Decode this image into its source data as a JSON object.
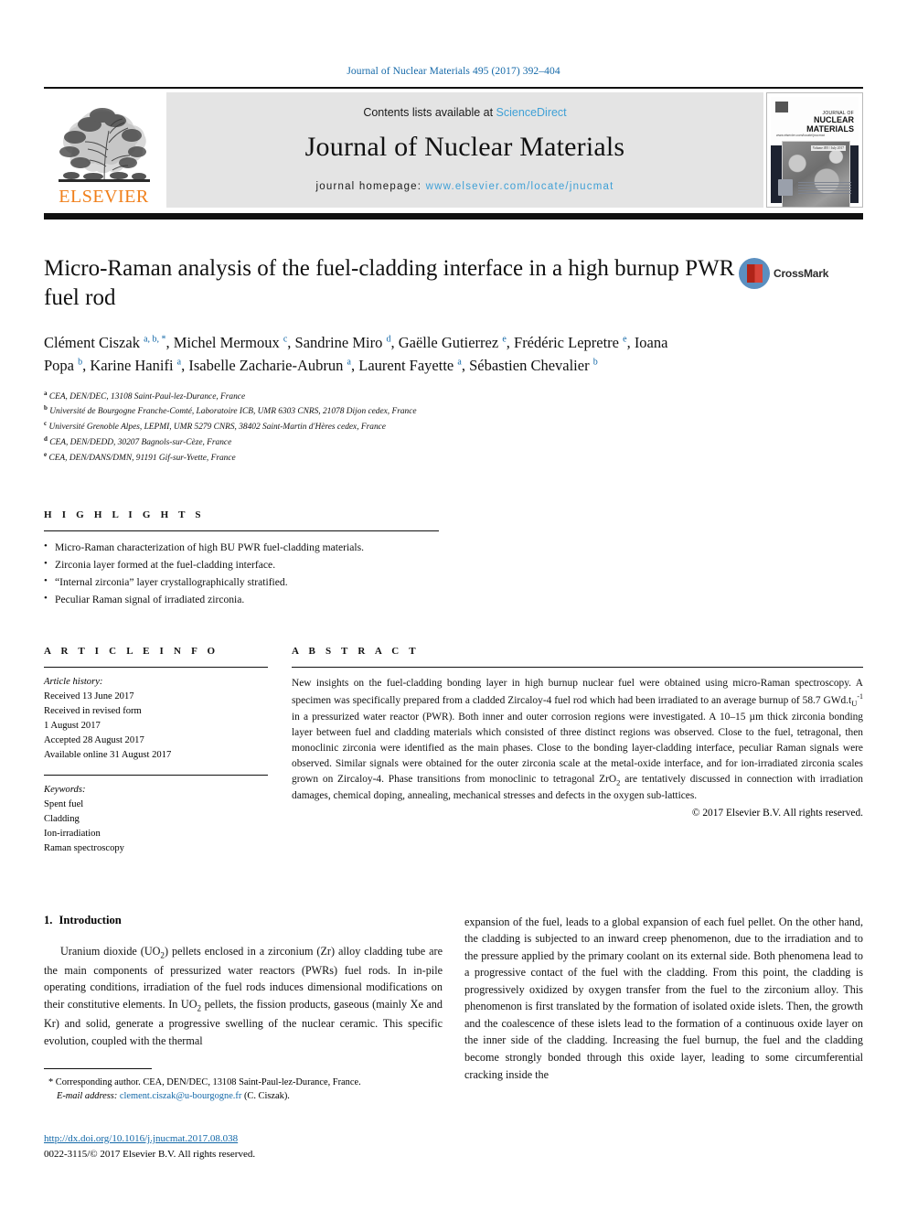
{
  "running_head": "Journal of Nuclear Materials 495 (2017) 392–404",
  "masthead": {
    "contents_prefix": "Contents lists available at ",
    "contents_link": "ScienceDirect",
    "journal_title": "Journal of Nuclear Materials",
    "homepage_prefix": "journal homepage: ",
    "homepage_url": "www.elsevier.com/locate/jnucmat",
    "publisher_wordmark": "ELSEVIER",
    "cover": {
      "title_line1": "JOURNAL OF",
      "title_line2": "NUCLEAR MATERIALS",
      "subtitle": "www.elsevier.com/locate/jnucmat",
      "figure_label": "Volume 495 / July 2017"
    }
  },
  "article": {
    "title": "Micro-Raman analysis of the fuel-cladding interface in a high burnup PWR fuel rod",
    "crossmark_label": "CrossMark",
    "authors_html": "Clément Ciszak <sup>a, b, *</sup>, Michel Mermoux <sup>c</sup>, Sandrine Miro <sup>d</sup>, Gaëlle Gutierrez <sup>e</sup>, Frédéric Lepretre <sup>e</sup>, Ioana Popa <sup>b</sup>, Karine Hanifi <sup>a</sup>, Isabelle Zacharie-Aubrun <sup>a</sup>, Laurent Fayette <sup>a</sup>, Sébastien Chevalier <sup>b</sup>",
    "affiliations": [
      {
        "marker": "a",
        "text": "CEA, DEN/DEC, 13108 Saint-Paul-lez-Durance, France"
      },
      {
        "marker": "b",
        "text": "Université de Bourgogne Franche-Comté, Laboratoire ICB, UMR 6303 CNRS, 21078 Dijon cedex, France"
      },
      {
        "marker": "c",
        "text": "Université Grenoble Alpes, LEPMI, UMR 5279 CNRS, 38402 Saint-Martin d'Hères cedex, France"
      },
      {
        "marker": "d",
        "text": "CEA, DEN/DEDD, 30207 Bagnols-sur-Cèze, France"
      },
      {
        "marker": "e",
        "text": "CEA, DEN/DANS/DMN, 91191 Gif-sur-Yvette, France"
      }
    ]
  },
  "highlights": {
    "label": "H I G H L I G H T S",
    "items": [
      "Micro-Raman characterization of high BU PWR fuel-cladding materials.",
      "Zirconia layer formed at the fuel-cladding interface.",
      "“Internal zirconia” layer crystallographically stratified.",
      "Peculiar Raman signal of irradiated zirconia."
    ]
  },
  "article_info": {
    "label": "A R T I C L E   I N F O",
    "history_label": "Article history:",
    "history": [
      "Received 13 June 2017",
      "Received in revised form",
      "1 August 2017",
      "Accepted 28 August 2017",
      "Available online 31 August 2017"
    ],
    "keywords_label": "Keywords:",
    "keywords": [
      "Spent fuel",
      "Cladding",
      "Ion-irradiation",
      "Raman spectroscopy"
    ]
  },
  "abstract": {
    "label": "A B S T R A C T",
    "text_html": "New insights on the fuel-cladding bonding layer in high burnup nuclear fuel were obtained using micro-Raman spectroscopy. A specimen was specifically prepared from a cladded Zircaloy-4 fuel rod which had been irradiated to an average burnup of 58.7 GWd.t<span class=\"sub\">U</span><span class=\"sup\">-1</span> in a pressurized water reactor (PWR). Both inner and outer corrosion regions were investigated. A 10&#8211;15 &#181;m thick zirconia bonding layer between fuel and cladding materials which consisted of three distinct regions was observed. Close to the fuel, tetragonal, then monoclinic zirconia were identified as the main phases. Close to the bonding layer-cladding interface, peculiar Raman signals were observed. Similar signals were obtained for the outer zirconia scale at the metal-oxide interface, and for ion-irradiated zirconia scales grown on Zircaloy-4. Phase transitions from monoclinic to tetragonal ZrO<span class=\"sub\">2</span> are tentatively discussed in connection with irradiation damages, chemical doping, annealing, mechanical stresses and defects in the oxygen sub-lattices.",
    "copyright": "© 2017 Elsevier B.V. All rights reserved."
  },
  "body": {
    "section_number": "1.",
    "section_title": "Introduction",
    "left_paragraph_html": "Uranium dioxide (UO<span class=\"sub\">2</span>) pellets enclosed in a zirconium (Zr) alloy cladding tube are the main components of pressurized water reactors (PWRs) fuel rods. In in-pile operating conditions, irradiation of the fuel rods induces dimensional modifications on their constitutive elements. In UO<span class=\"sub\">2</span> pellets, the fission products, gaseous (mainly Xe and Kr) and solid, generate a progressive swelling of the nuclear ceramic. This specific evolution, coupled with the thermal",
    "right_paragraph_html": "expansion of the fuel, leads to a global expansion of each fuel pellet. On the other hand, the cladding is subjected to an inward creep phenomenon, due to the irradiation and to the pressure applied by the primary coolant on its external side. Both phenomena lead to a progressive contact of the fuel with the cladding. From this point, the cladding is progressively oxidized by oxygen transfer from the fuel to the zirconium alloy. This phenomenon is first translated by the formation of isolated oxide islets. Then, the growth and the coalescence of these islets lead to the formation of a continuous oxide layer on the inner side of the cladding. Increasing the fuel burnup, the fuel and the cladding become strongly bonded through this oxide layer, leading to some circumferential cracking inside the"
  },
  "footnotes": {
    "corresponding_html": "* Corresponding author. CEA, DEN/DEC, 13108 Saint-Paul-lez-Durance, France.",
    "email_label": "E-mail address:",
    "email": "clement.ciszak@u-bourgogne.fr",
    "email_suffix": "(C. Ciszak).",
    "doi": "http://dx.doi.org/10.1016/j.jnucmat.2017.08.038",
    "issn_line": "0022-3115/© 2017 Elsevier B.V. All rights reserved."
  },
  "colors": {
    "link_blue": "#1368a8",
    "sciencedirect_blue": "#3fa0d6",
    "elsevier_orange": "#f07f1a"
  }
}
